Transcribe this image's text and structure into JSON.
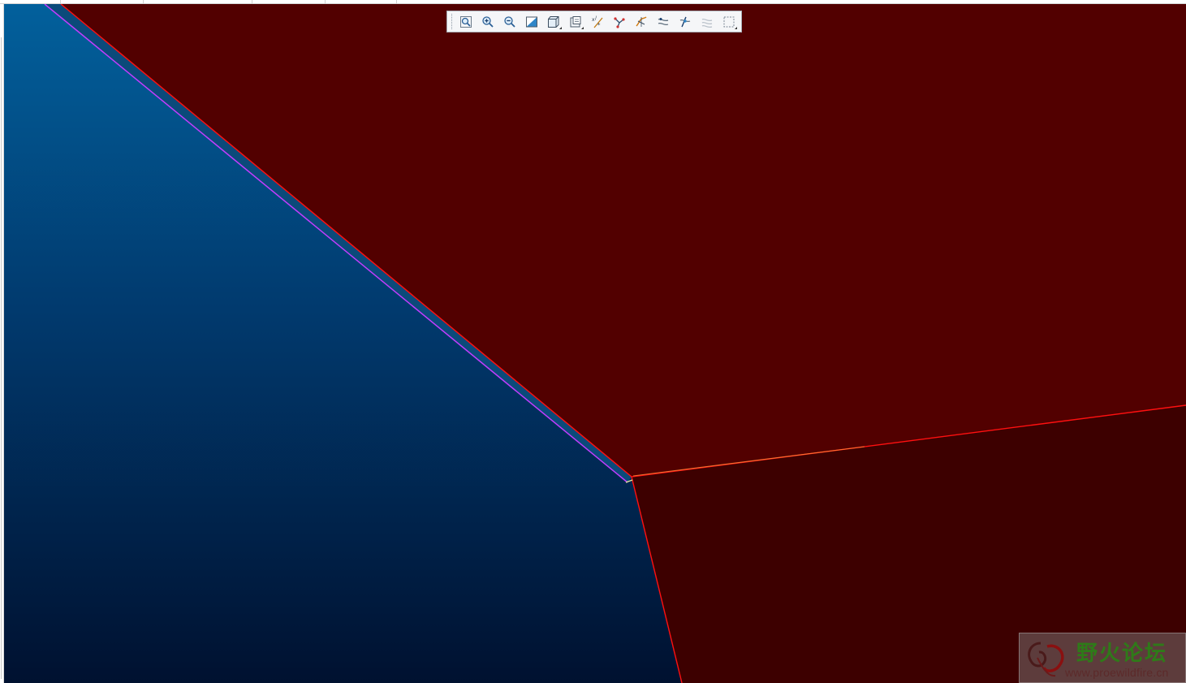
{
  "window": {
    "viewport_colors": {
      "background_top": "#02609c",
      "background_bottom": "#001130",
      "surface_upper": "#520000",
      "surface_lower": "#3d0000",
      "edge": "#ff1010",
      "highlight_edge": "#c43cff"
    }
  },
  "graphics_toolbar": {
    "buttons": [
      {
        "name": "refit-icon",
        "has_flyout": false
      },
      {
        "name": "zoom-in-icon",
        "has_flyout": false
      },
      {
        "name": "zoom-out-icon",
        "has_flyout": false
      },
      {
        "name": "repaint-icon",
        "has_flyout": false
      },
      {
        "name": "display-style-icon",
        "has_flyout": true
      },
      {
        "name": "saved-orientations-icon",
        "has_flyout": true
      },
      {
        "name": "datum-display-icon",
        "has_flyout": false
      },
      {
        "name": "annotation-display-icon",
        "has_flyout": false
      },
      {
        "name": "plane-display-icon",
        "has_flyout": false
      },
      {
        "name": "axis-display-icon",
        "has_flyout": false
      },
      {
        "name": "point-display-icon",
        "has_flyout": false
      },
      {
        "name": "csys-display-icon",
        "has_flyout": false
      },
      {
        "name": "spin-center-icon",
        "has_flyout": true
      }
    ]
  },
  "watermark": {
    "title": "野火论坛",
    "url": "www.proewildfire.cn"
  }
}
